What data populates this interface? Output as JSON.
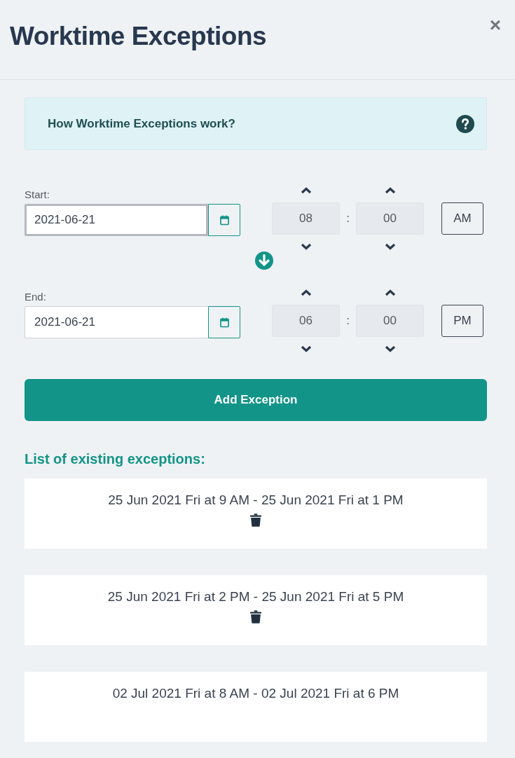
{
  "header": {
    "title": "Worktime Exceptions",
    "close": "×"
  },
  "info": {
    "text": "How Worktime Exceptions work?"
  },
  "ranges": [
    {
      "label": "Start:",
      "date": "2021-06-21",
      "focused": true,
      "hour": "08",
      "separator": ":",
      "minute": "00",
      "meridiem": "AM"
    },
    {
      "label": "End:",
      "date": "2021-06-21",
      "focused": false,
      "hour": "06",
      "separator": ":",
      "minute": "00",
      "meridiem": "PM"
    }
  ],
  "add_button": "Add Exception",
  "list_heading": "List of existing exceptions:",
  "exceptions": [
    {
      "text": "25 Jun 2021 Fri at 9 AM - 25 Jun 2021 Fri at 1 PM",
      "delete_visible": true
    },
    {
      "text": "25 Jun 2021 Fri at 2 PM - 25 Jun 2021 Fri at 5 PM",
      "delete_visible": true
    },
    {
      "text": "02 Jul 2021 Fri at 8 AM - 02 Jul 2021 Fri at 6 PM",
      "delete_visible": false
    }
  ]
}
